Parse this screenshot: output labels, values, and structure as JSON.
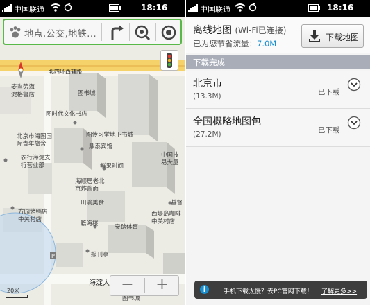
{
  "left_screen": {
    "statusbar": {
      "carrier": "中国联通",
      "time": "18:16"
    },
    "search": {
      "placeholder": "地点,公交,地铁..."
    },
    "map": {
      "labels": [
        {
          "id": "xiangui",
          "text": "麦当劳海\n淀格鲁店"
        },
        {
          "id": "tushucheng",
          "text": "图书城"
        },
        {
          "id": "shidai",
          "text": "图时代文化书店"
        },
        {
          "id": "beijingtushu",
          "text": "北京市海图国\n际青年旅舍"
        },
        {
          "id": "yingshuoke",
          "text": "图传习堂地下书城"
        },
        {
          "id": "dingsheng",
          "text": "鼎泰宾馆"
        },
        {
          "id": "nongxing",
          "text": "农行海淀支\n行营业部"
        },
        {
          "id": "xianyu",
          "text": "鲜果时间"
        },
        {
          "id": "zhongguojiao",
          "text": "中国技\n易大厦"
        },
        {
          "id": "haidianlao",
          "text": "海顺居老北\n京炸酱面"
        },
        {
          "id": "chuanyu",
          "text": "川渝美食"
        },
        {
          "id": "jiemao",
          "text": "基督"
        },
        {
          "id": "fangyuan",
          "text": "方园烤鸭店\n中关村店"
        },
        {
          "id": "xiba",
          "text": "西堤岛咖啡\n中关村店"
        },
        {
          "id": "jiaoyu",
          "text": "安踏体育"
        },
        {
          "id": "jipin",
          "text": "籍海楼"
        },
        {
          "id": "baokan",
          "text": "报刊亭"
        },
        {
          "id": "haidiandajie",
          "text": "海淀大街"
        },
        {
          "id": "beisihuan",
          "text": "北四环西辅路"
        },
        {
          "id": "bottom_lbl",
          "text": "图书城"
        }
      ],
      "scale": "20米",
      "zoom_out": "−",
      "zoom_in": "+"
    }
  },
  "right_screen": {
    "statusbar": {
      "carrier": "中国联通",
      "time": "18:16"
    },
    "header": {
      "title": "离线地图",
      "wifi_status": "(Wi-Fi已连接)",
      "saving_label": "已为您节省流量：",
      "saving_value": "7.0M",
      "download_button": "下载地图"
    },
    "section_title": "下载完成",
    "items": [
      {
        "name": "北京市",
        "size": "(13.3M)",
        "status": "已下载"
      },
      {
        "name": "全国概略地图包",
        "size": "(27.2M)",
        "status": "已下载"
      }
    ],
    "toast": {
      "message": "手机下载太慢？去PC官网下载！",
      "more": "了解更多>>"
    }
  },
  "colors": {
    "accent_green": "#58b848",
    "link_blue": "#1a8fd0",
    "section_gray": "#a8adb8"
  }
}
